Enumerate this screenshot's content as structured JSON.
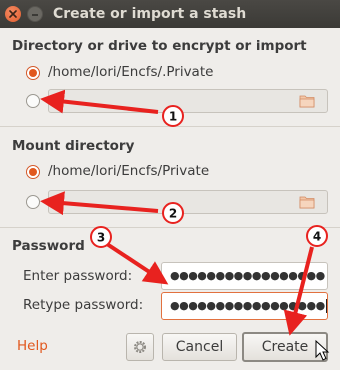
{
  "window": {
    "title": "Create or import a stash"
  },
  "source": {
    "section_title": "Directory or drive to encrypt or import",
    "option_default_path": "/home/lori/Encfs/.Private",
    "custom_path_value": ""
  },
  "mount": {
    "section_title": "Mount directory",
    "option_default_path": "/home/lori/Encfs/Private",
    "custom_path_value": ""
  },
  "password": {
    "section_title": "Password",
    "enter_label": "Enter password:",
    "enter_value": "●●●●●●●●●●●●●●●●●",
    "retype_label": "Retype password:",
    "retype_value": "●●●●●●●●●●●●●●●●●"
  },
  "footer": {
    "help_label": "Help",
    "cancel_label": "Cancel",
    "create_label": "Create"
  },
  "annotations": [
    "1",
    "2",
    "3",
    "4"
  ],
  "colors": {
    "accent": "#e1581e",
    "arrow": "#e8221f",
    "titlebar": "#3b3a36"
  }
}
